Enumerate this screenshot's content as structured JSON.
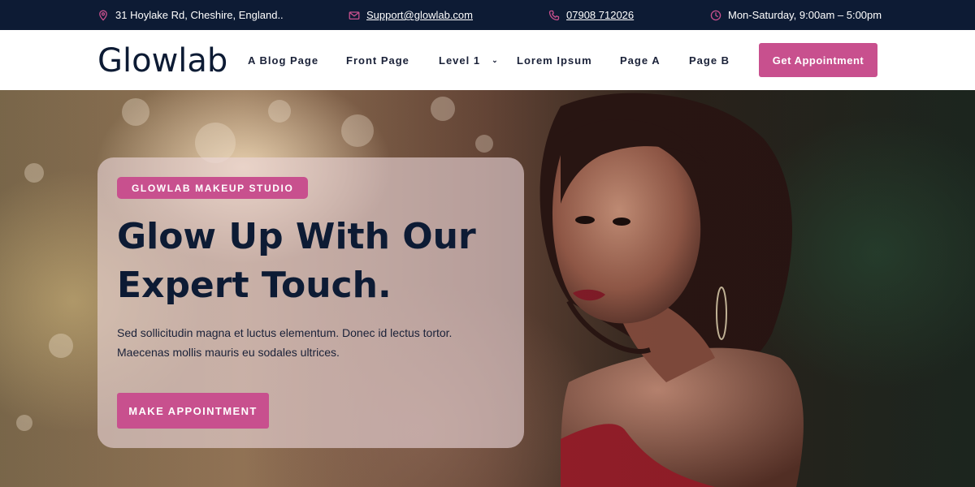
{
  "topbar": {
    "address": "31 Hoylake Rd, Cheshire, England..",
    "email": "Support@glowlab.com",
    "phone": "07908 712026",
    "hours": "Mon-Saturday, 9:00am – 5:00pm",
    "address_icon": "map-pin-icon",
    "email_icon": "envelope-icon",
    "phone_icon": "phone-icon",
    "hours_icon": "clock-icon"
  },
  "nav": {
    "logo": "Glowlab",
    "links": [
      {
        "label": "A Blog Page"
      },
      {
        "label": "Front Page"
      },
      {
        "label": "Level 1",
        "has_dropdown": true
      },
      {
        "label": "Lorem Ipsum"
      },
      {
        "label": "Page A"
      },
      {
        "label": "Page B"
      }
    ],
    "cta_label": "Get Appointment"
  },
  "hero": {
    "badge": "GLOWLAB MAKEUP STUDIO",
    "title_line1": "Glow Up With Our",
    "title_line2": "Expert Touch.",
    "description_line1": "Sed sollicitudin magna et luctus elementum. Donec id lectus tortor.",
    "description_line2": "Maecenas mollis mauris eu sodales ultrices.",
    "cta_label": "MAKE APPOINTMENT"
  },
  "colors": {
    "navy": "#0d1b34",
    "accent": "#c8508e",
    "white": "#ffffff"
  }
}
